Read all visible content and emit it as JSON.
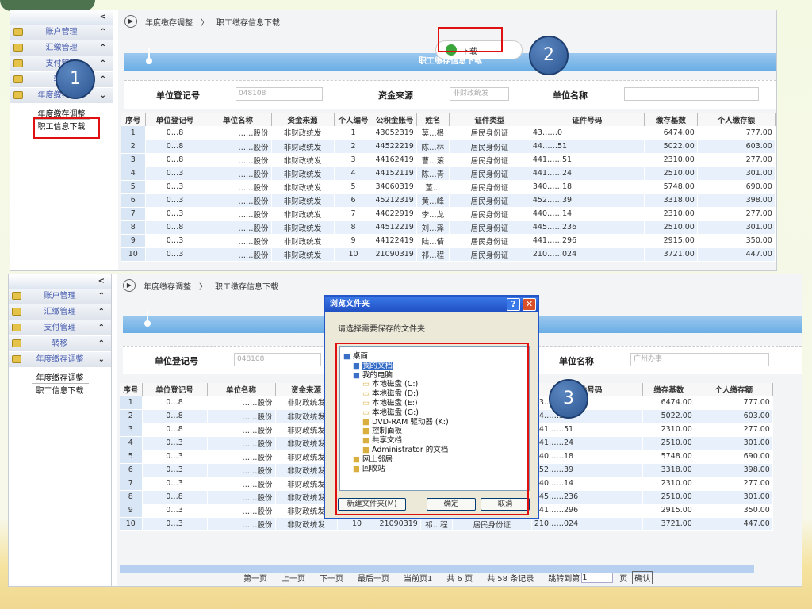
{
  "sidebar": {
    "collapse": "<",
    "menus": [
      "账户管理",
      "汇缴管理",
      "支付管理",
      "转移",
      "年度缴存调整"
    ],
    "submenu": [
      "年度缴存调整",
      "职工信息下载"
    ]
  },
  "breadcrumb": {
    "parent": "年度缴存调整",
    "sep": "〉",
    "current": "职工缴存信息下载"
  },
  "download_label": "下载",
  "section_title": "职工缴存信息下载",
  "filters": {
    "reg_label": "单位登记号",
    "reg_value": "048108",
    "source_label": "资金来源",
    "source_value": "非财政统发",
    "name_label": "单位名称",
    "name_value_bottom": "广州办事"
  },
  "table": {
    "headers": [
      "序号",
      "单位登记号",
      "单位名称",
      "资金来源",
      "个人编号",
      "公积金账号",
      "姓名",
      "证件类型",
      "证件号码",
      "缴存基数",
      "个人缴存额"
    ],
    "rows": [
      [
        "1",
        "0…8",
        "……股份",
        "非财政统发",
        "1",
        "43052319",
        "莫…根",
        "居民身份证",
        "43……0",
        "6474.00",
        "777.00"
      ],
      [
        "2",
        "0…8",
        "……股份",
        "非财政统发",
        "2",
        "44522219",
        "陈…林",
        "居民身份证",
        "44……51",
        "5022.00",
        "603.00"
      ],
      [
        "3",
        "0…8",
        "……股份",
        "非财政统发",
        "3",
        "44162419",
        "曹…滚",
        "居民身份证",
        "441……51",
        "2310.00",
        "277.00"
      ],
      [
        "4",
        "0…3",
        "……股份",
        "非财政统发",
        "4",
        "44152119",
        "陈…青",
        "居民身份证",
        "441……24",
        "2510.00",
        "301.00"
      ],
      [
        "5",
        "0…3",
        "……股份",
        "非财政统发",
        "5",
        "34060319",
        "董…",
        "居民身份证",
        "340……18",
        "5748.00",
        "690.00"
      ],
      [
        "6",
        "0…3",
        "……股份",
        "非财政统发",
        "6",
        "45212319",
        "黄…峰",
        "居民身份证",
        "452……39",
        "3318.00",
        "398.00"
      ],
      [
        "7",
        "0…3",
        "……股份",
        "非财政统发",
        "7",
        "44022919",
        "李…龙",
        "居民身份证",
        "440……14",
        "2310.00",
        "277.00"
      ],
      [
        "8",
        "0…8",
        "……股份",
        "非财政统发",
        "8",
        "44512219",
        "刘…泽",
        "居民身份证",
        "445……236",
        "2510.00",
        "301.00"
      ],
      [
        "9",
        "0…3",
        "……股份",
        "非财政统发",
        "9",
        "44122419",
        "陆…倩",
        "居民身份证",
        "441……296",
        "2915.00",
        "350.00"
      ],
      [
        "10",
        "0…3",
        "……股份",
        "非财政统发",
        "10",
        "21090319",
        "祁…程",
        "居民身份证",
        "210……024",
        "3721.00",
        "447.00"
      ]
    ]
  },
  "dialog": {
    "title": "浏览文件夹",
    "help": "?",
    "close": "✕",
    "prompt": "请选择需要保存的文件夹",
    "tree": [
      "桌面",
      "我的文档",
      "我的电脑",
      "本地磁盘 (C:)",
      "本地磁盘 (D:)",
      "本地磁盘 (E:)",
      "本地磁盘 (G:)",
      "DVD-RAM 驱动器 (K:)",
      "控制面板",
      "共享文档",
      "Administrator 的文档",
      "网上邻居",
      "回收站"
    ],
    "new_folder": "新建文件夹(M)",
    "ok": "确定",
    "cancel": "取消"
  },
  "pager": {
    "first": "第一页",
    "prev": "上一页",
    "next": "下一页",
    "last": "最后一页",
    "current": "当前页1",
    "pages": "共 6 页",
    "records": "共 58 条记录",
    "goto": "跳转到第",
    "goto_value": "1",
    "page_unit": "页",
    "confirm": "确认"
  },
  "callouts": [
    "1",
    "2",
    "3"
  ]
}
